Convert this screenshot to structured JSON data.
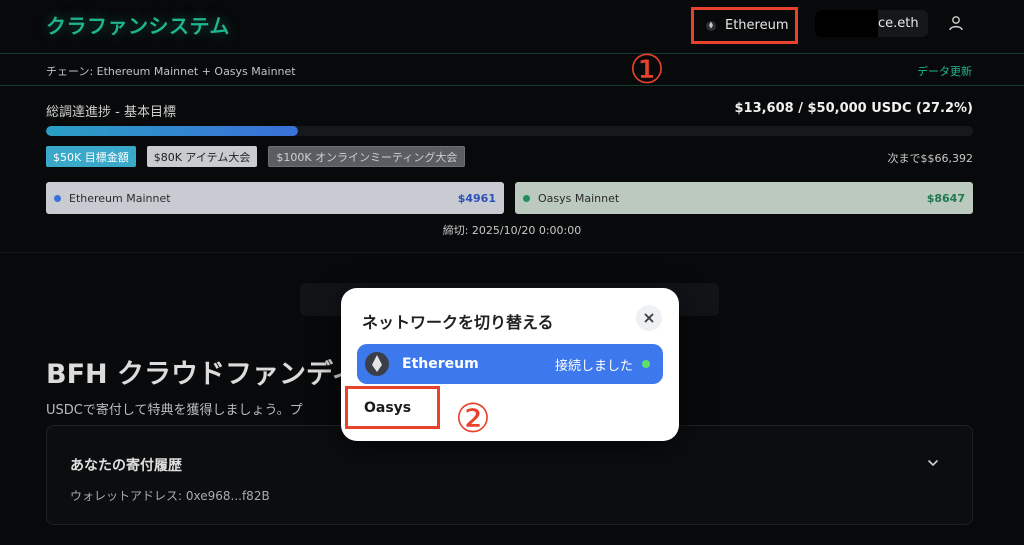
{
  "header": {
    "logo": "クラファンシステム",
    "network_button": "Ethereum",
    "wallet_address": "ce.eth",
    "user_icon": "user-icon"
  },
  "chain_bar": {
    "chains": "チェーン: Ethereum Mainnet + Oasys Mainnet",
    "refresh": "データ更新"
  },
  "annotations": {
    "one": "①",
    "two": "②",
    "color": "#e8412c"
  },
  "progress": {
    "title": "総調達進捗 - 基本目標",
    "amount": "$13,608 / $50,000 USDC (27.2%)",
    "percent": 27.2,
    "milestones": [
      "$50K 目標金額",
      "$80K アイテム大会",
      "$100K オンラインミーティング大会"
    ],
    "next": "次まで$$66,392",
    "chains": [
      {
        "name": "Ethereum Mainnet",
        "amount": "$4961",
        "color": "#3a6fd8"
      },
      {
        "name": "Oasys Mainnet",
        "amount": "$8647",
        "color": "#1e8f5c"
      }
    ],
    "deadline": "締切: 2025/10/20 0:00:00"
  },
  "main": {
    "title": "BFH クラウドファンディ",
    "subtitle": "USDCで寄付して特典を獲得しましょう。プ",
    "history": {
      "title": "あなたの寄付履歴",
      "address": "ウォレットアドレス: 0xe968...f82B"
    }
  },
  "modal": {
    "title": "ネットワークを切り替える",
    "active_network": "Ethereum",
    "active_status": "接続しました",
    "other_network": "Oasys"
  },
  "colors": {
    "accent": "#1fb58f",
    "primary_blue": "#3d78ec",
    "connected": "#5fe06a"
  }
}
